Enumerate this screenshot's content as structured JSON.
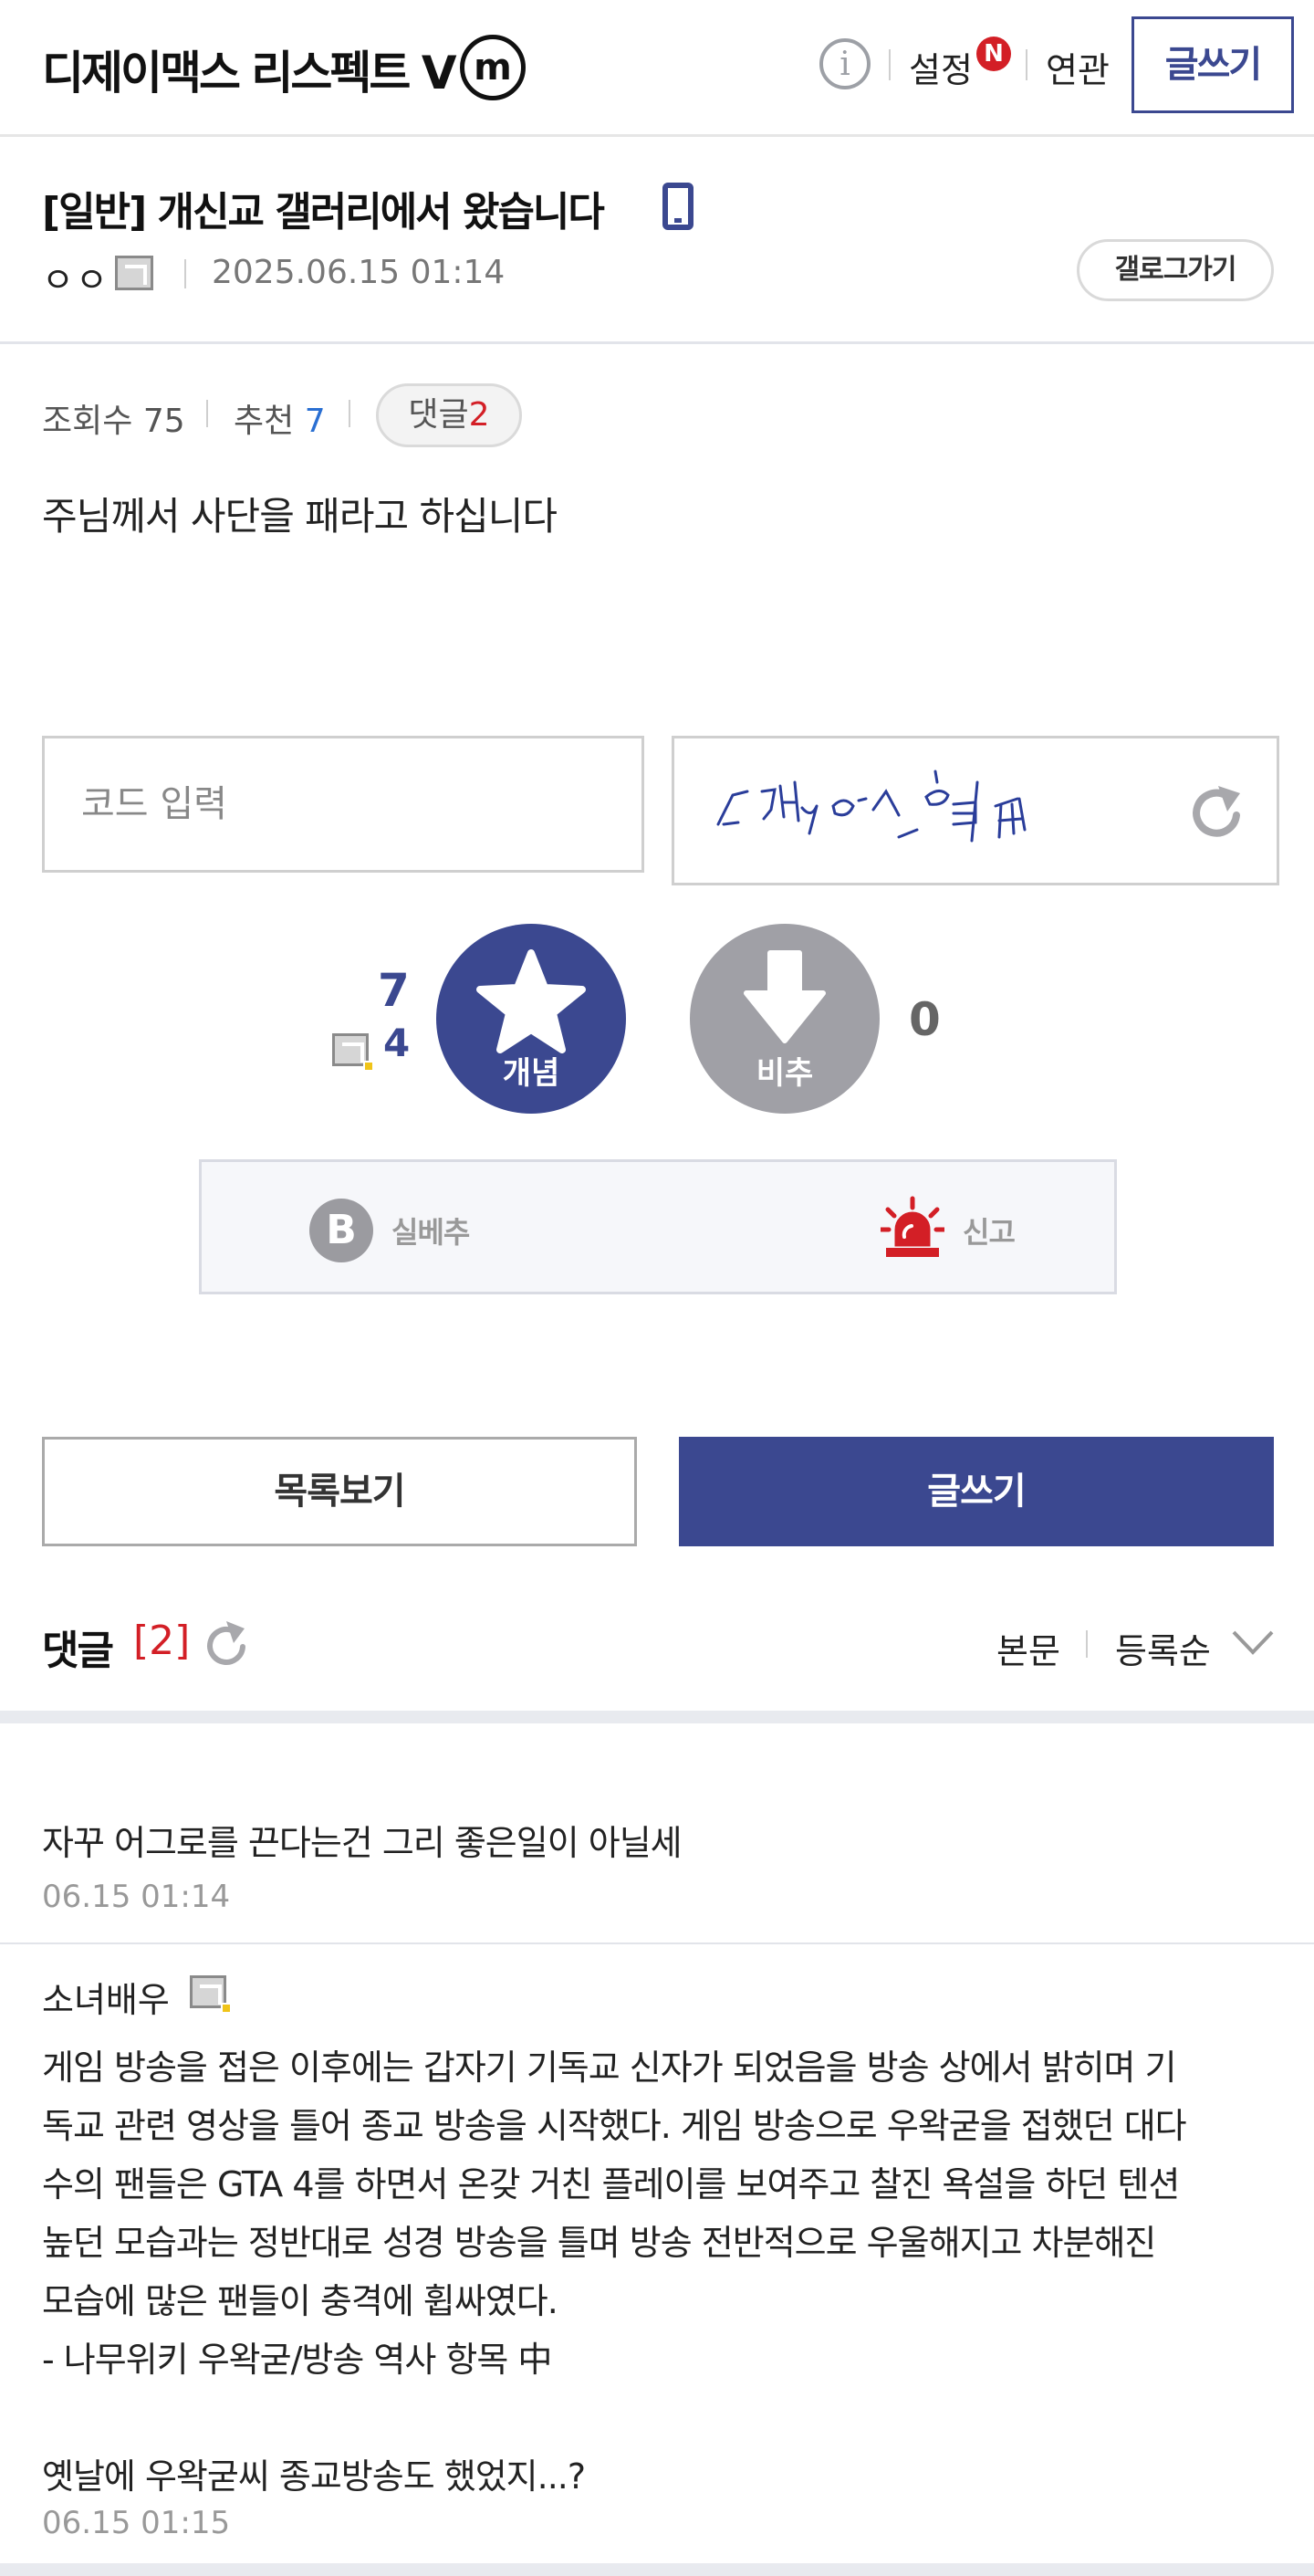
{
  "header": {
    "gallery_title": "디제이맥스 리스펙트 V",
    "minor_badge": "m",
    "info_icon": "info-icon",
    "settings_label": "설정",
    "new_badge": "N",
    "related_label": "연관",
    "write_label": "글쓰기"
  },
  "post": {
    "title": "[일반] 개신교 갤러리에서 왔습니다",
    "author": "ㅇㅇ",
    "datetime": "2025.06.15 01:14",
    "gallog_button": "갤로그가기",
    "views_label": "조회수",
    "views": "75",
    "recommend_label": "추천",
    "recommend": "7",
    "comments_label": "댓글",
    "comments": "2",
    "body": "주님께서 사단을 패라고 하십니다"
  },
  "captcha": {
    "placeholder": "코드 입력",
    "refresh_icon": "refresh-icon"
  },
  "votes": {
    "up_total": "7",
    "up_fixed": "4",
    "up_label": "개념",
    "down_total": "0",
    "down_label": "비추"
  },
  "report": {
    "best_badge": "B",
    "best_label": "실베추",
    "report_label": "신고"
  },
  "actions": {
    "list_label": "목록보기",
    "write_label": "글쓰기"
  },
  "comments_section": {
    "title": "댓글",
    "count": "[2]",
    "sort_body": "본문",
    "sort_order": "등록순",
    "items": [
      {
        "nick": "",
        "lines": [
          "자꾸 어그로를 끈다는건 그리 좋은일이 아닐세"
        ],
        "date": "06.15 01:14"
      },
      {
        "nick": "소녀배우",
        "lines": [
          "게임 방송을 접은 이후에는 갑자기 기독교 신자가 되었음을 방송 상에서 밝히며 기",
          "독교 관련 영상을 틀어 종교 방송을 시작했다. 게임 방송으로 우왁굳을 접했던 대다",
          "수의 팬들은 GTA 4를 하면서 온갖 거친 플레이를 보여주고 찰진 욕설을 하던 텐션",
          "높던 모습과는 정반대로 성경 방송을 틀며 방송 전반적으로 우울해지고 차분해진",
          "모습에 많은 팬들이 충격에 휩싸였다.",
          "- 나무위키 우왁굳/방송 역사 항목 中",
          "",
          "옛날에 우왁굳씨 종교방송도 했었지...?"
        ],
        "date": "06.15 01:15"
      }
    ]
  },
  "colors": {
    "brand": "#3b4890",
    "accent_red": "#d31f26",
    "link_blue": "#2a6fd2",
    "down_gray": "#a0a0a6"
  }
}
